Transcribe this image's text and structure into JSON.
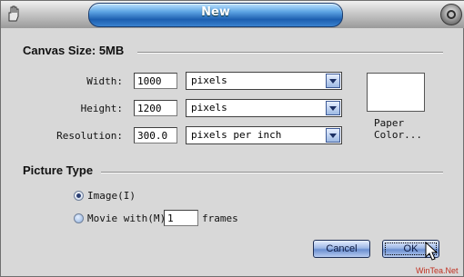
{
  "window": {
    "title": "New"
  },
  "canvas": {
    "heading": "Canvas Size: 5MB"
  },
  "width": {
    "label": "Width:",
    "value": "1000",
    "unit": "pixels"
  },
  "height": {
    "label": "Height:",
    "value": "1200",
    "unit": "pixels"
  },
  "resolution": {
    "label": "Resolution:",
    "value": "300.0",
    "unit": "pixels per inch"
  },
  "paper": {
    "label": "Paper\nColor..."
  },
  "picture": {
    "heading": "Picture Type",
    "image_option": "Image(I)",
    "movie_option": "Movie with(M)",
    "frames_value": "1",
    "frames_label": "frames",
    "selected": "image"
  },
  "buttons": {
    "cancel": "Cancel",
    "ok": "OK"
  },
  "watermark": "WinTea.Net",
  "colors": {
    "title_accent": "#1d5fb0",
    "paper_color": "#ffffff",
    "button_accent": "#6b8fd0"
  }
}
